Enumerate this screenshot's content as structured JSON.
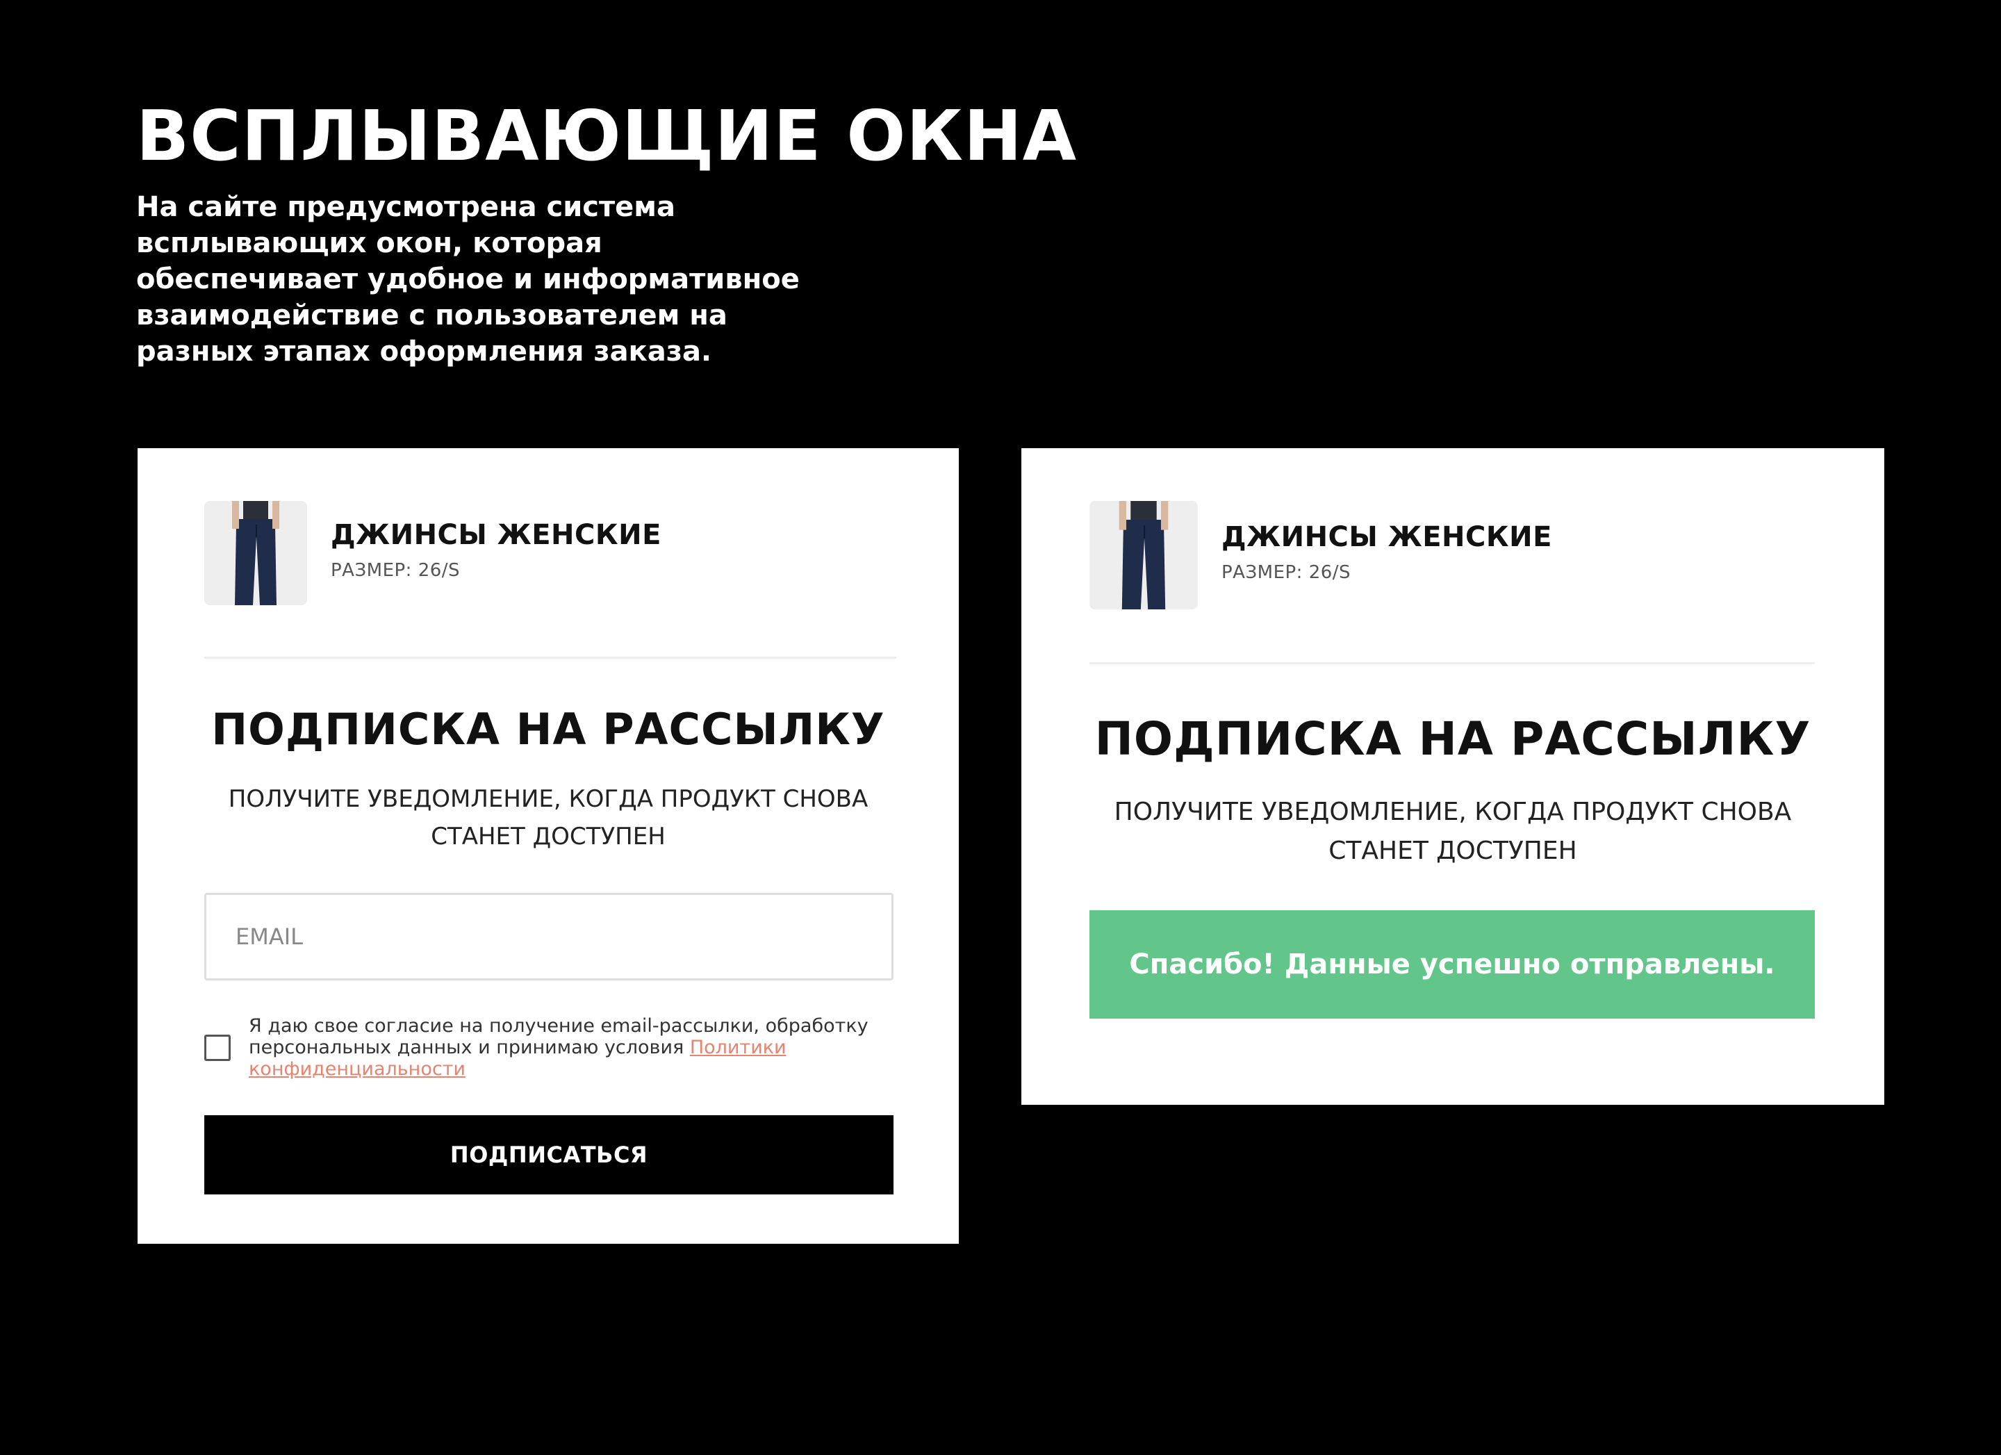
{
  "page": {
    "title": "ВСПЛЫВАЮЩИЕ ОКНА",
    "description": "На сайте предусмотрена система всплывающих окон, которая обеспечивает удобное и информативное взаимодействие с пользователем на разных этапах оформления заказа."
  },
  "popup_form": {
    "product": {
      "name": "ДЖИНСЫ ЖЕНСКИЕ",
      "size": "РАЗМЕР: 26/S",
      "image_icon": "jeans-icon"
    },
    "title": "ПОДПИСКА НА РАССЫЛКУ",
    "subtitle": "ПОЛУЧИТЕ УВЕДОМЛЕНИЕ, КОГДА ПРОДУКТ СНОВА СТАНЕТ ДОСТУПЕН",
    "email_placeholder": "EMAIL",
    "email_value": "",
    "consent_text": "Я даю свое согласие на получение email-рассылки, обработку персональных данных и принимаю условия ",
    "consent_link": "Политики конфиденциальности",
    "consent_checked": false,
    "button_label": "ПОДПИСАТЬСЯ"
  },
  "popup_success": {
    "product": {
      "name": "ДЖИНСЫ ЖЕНСКИЕ",
      "size": "РАЗМЕР: 26/S",
      "image_icon": "jeans-icon"
    },
    "title": "ПОДПИСКА НА РАССЫЛКУ",
    "subtitle": "ПОЛУЧИТЕ УВЕДОМЛЕНИЕ, КОГДА ПРОДУКТ СНОВА СТАНЕТ ДОСТУПЕН",
    "success_message": "Спасибо! Данные успешно отправлены."
  },
  "colors": {
    "background": "#000000",
    "card": "#ffffff",
    "button": "#000000",
    "success": "#62c68a",
    "link": "#e8846e"
  }
}
